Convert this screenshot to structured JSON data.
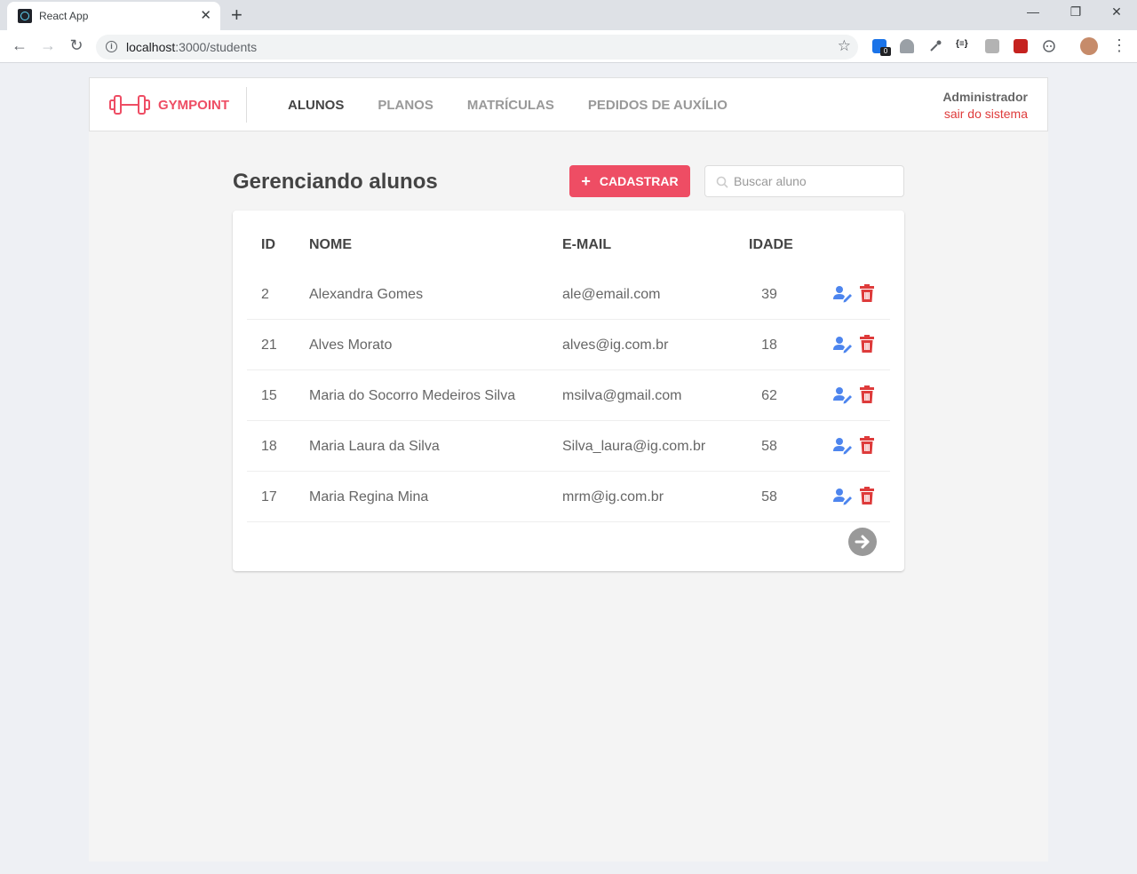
{
  "browser": {
    "tab_title": "React App",
    "url_host": "localhost",
    "url_path": ":3000/students",
    "extension_badge": "0"
  },
  "header": {
    "brand": "GYMPOINT",
    "nav": [
      "ALUNOS",
      "PLANOS",
      "MATRÍCULAS",
      "PEDIDOS DE AUXÍLIO"
    ],
    "active_nav": "ALUNOS",
    "user_name": "Administrador",
    "logout_label": "sair do sistema"
  },
  "main": {
    "title": "Gerenciando alunos",
    "add_label": "CADASTRAR",
    "search_placeholder": "Buscar aluno"
  },
  "table": {
    "columns": [
      "ID",
      "NOME",
      "E-MAIL",
      "IDADE"
    ],
    "rows": [
      {
        "id": "2",
        "name": "Alexandra Gomes",
        "email": "ale@email.com",
        "age": "39"
      },
      {
        "id": "21",
        "name": "Alves Morato",
        "email": "alves@ig.com.br",
        "age": "18"
      },
      {
        "id": "15",
        "name": "Maria do Socorro Medeiros Silva",
        "email": "msilva@gmail.com",
        "age": "62"
      },
      {
        "id": "18",
        "name": "Maria Laura da Silva",
        "email": "Silva_laura@ig.com.br",
        "age": "58"
      },
      {
        "id": "17",
        "name": "Maria Regina Mina",
        "email": "mrm@ig.com.br",
        "age": "58"
      }
    ]
  },
  "colors": {
    "brand": "#ee4d64",
    "edit_icon": "#4d85ee",
    "delete_icon": "#de3b3b"
  },
  "icons": {
    "brand": "dumbbell-icon",
    "add": "plus-icon",
    "search": "search-icon",
    "edit": "user-edit-icon",
    "delete": "trash-icon",
    "next_page": "arrow-right-circle-icon"
  }
}
